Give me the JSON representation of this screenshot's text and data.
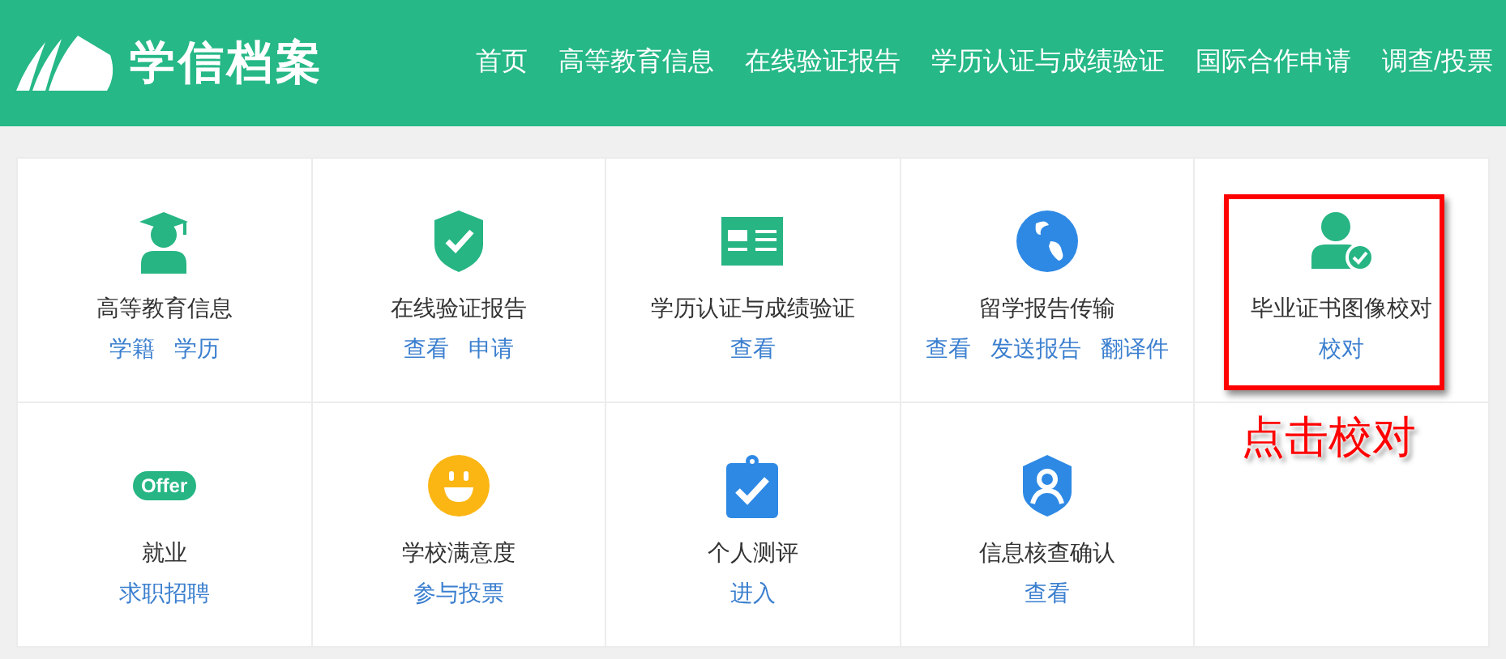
{
  "header": {
    "brand": "学信档案",
    "nav": [
      {
        "label": "首页"
      },
      {
        "label": "高等教育信息"
      },
      {
        "label": "在线验证报告"
      },
      {
        "label": "学历认证与成绩验证"
      },
      {
        "label": "国际合作申请"
      },
      {
        "label": "调查/投票"
      }
    ]
  },
  "services": [
    {
      "kind": "graduate",
      "title": "高等教育信息",
      "links": [
        "学籍",
        "学历"
      ],
      "highlighted": false
    },
    {
      "kind": "shield-check",
      "title": "在线验证报告",
      "links": [
        "查看",
        "申请"
      ],
      "highlighted": false
    },
    {
      "kind": "id-card",
      "title": "学历认证与成绩验证",
      "links": [
        "查看"
      ],
      "highlighted": false
    },
    {
      "kind": "globe",
      "title": "留学报告传输",
      "links": [
        "查看",
        "发送报告",
        "翻译件"
      ],
      "highlighted": false
    },
    {
      "kind": "person-check",
      "title": "毕业证书图像校对",
      "links": [
        "校对"
      ],
      "highlighted": true,
      "callout": "点击校对"
    },
    {
      "kind": "offer",
      "icon_text": "Offer",
      "title": "就业",
      "links": [
        "求职招聘"
      ],
      "highlighted": false
    },
    {
      "kind": "smiley",
      "title": "学校满意度",
      "links": [
        "参与投票"
      ],
      "highlighted": false
    },
    {
      "kind": "clipboard-check",
      "title": "个人测评",
      "links": [
        "进入"
      ],
      "highlighted": false
    },
    {
      "kind": "shield-user",
      "title": "信息核查确认",
      "links": [
        "查看"
      ],
      "highlighted": false
    }
  ]
}
